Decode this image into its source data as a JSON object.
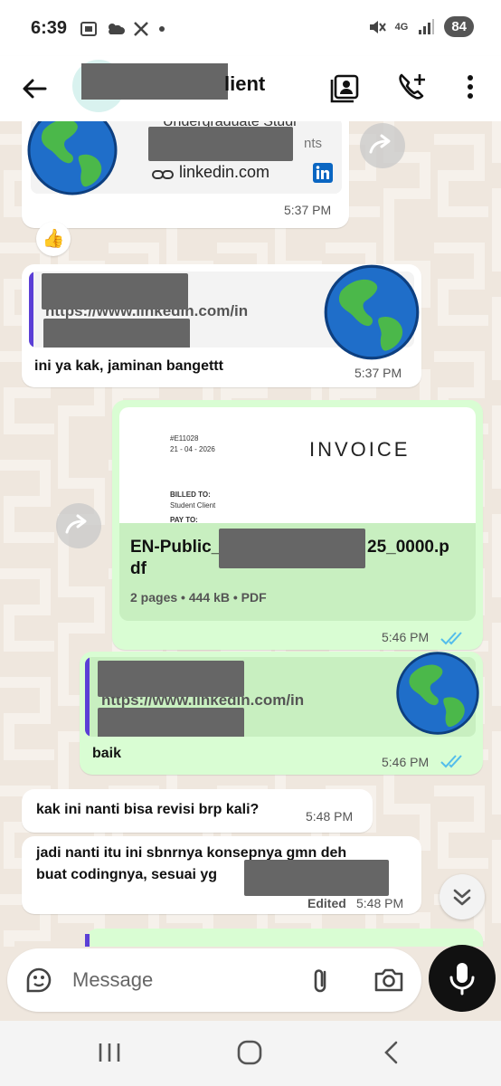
{
  "status": {
    "time": "6:39",
    "network": "4G",
    "battery": "84"
  },
  "header": {
    "title_visible": "lient"
  },
  "messages": {
    "m1": {
      "preview_title_fragment": "Undergraduate Studi",
      "preview_sub_fragment": "nts",
      "link_host": "linkedin.com",
      "time": "5:37 PM",
      "reaction": "👍"
    },
    "m2": {
      "quoted_url": "https://www.linkedin.com/in",
      "text": "ini ya kak, jaminan bangettt",
      "time": "5:37 PM"
    },
    "m3": {
      "invoice_number": "#E11028",
      "invoice_date": "21 - 04 - 2026",
      "invoice_heading": "INVOICE",
      "billed_to_label": "BILLED TO:",
      "billed_to_value": "Student Client",
      "pay_to_label": "PAY TO:",
      "file_name_start": "EN-Public_",
      "file_name_end": "25_0000.p",
      "file_name_wrap": "df",
      "file_meta": "2 pages • 444 kB • PDF",
      "time": "5:46 PM"
    },
    "m4": {
      "quoted_url": "https://www.linkedin.com/in",
      "text": "baik",
      "time": "5:46 PM"
    },
    "m5": {
      "text": "kak ini nanti bisa revisi brp kali?",
      "time": "5:48 PM"
    },
    "m6": {
      "line1": "jadi nanti itu ini sbnrnya konsepnya gmn deh",
      "line2": "buat codingnya, sesuai yg",
      "edited": "Edited",
      "time": "5:48 PM"
    }
  },
  "composer": {
    "placeholder": "Message"
  },
  "colors": {
    "outgoing": "#d9fdd3",
    "incoming": "#ffffff",
    "read_ticks": "#53bdeb",
    "quote_bar": "#5b3fd6"
  }
}
